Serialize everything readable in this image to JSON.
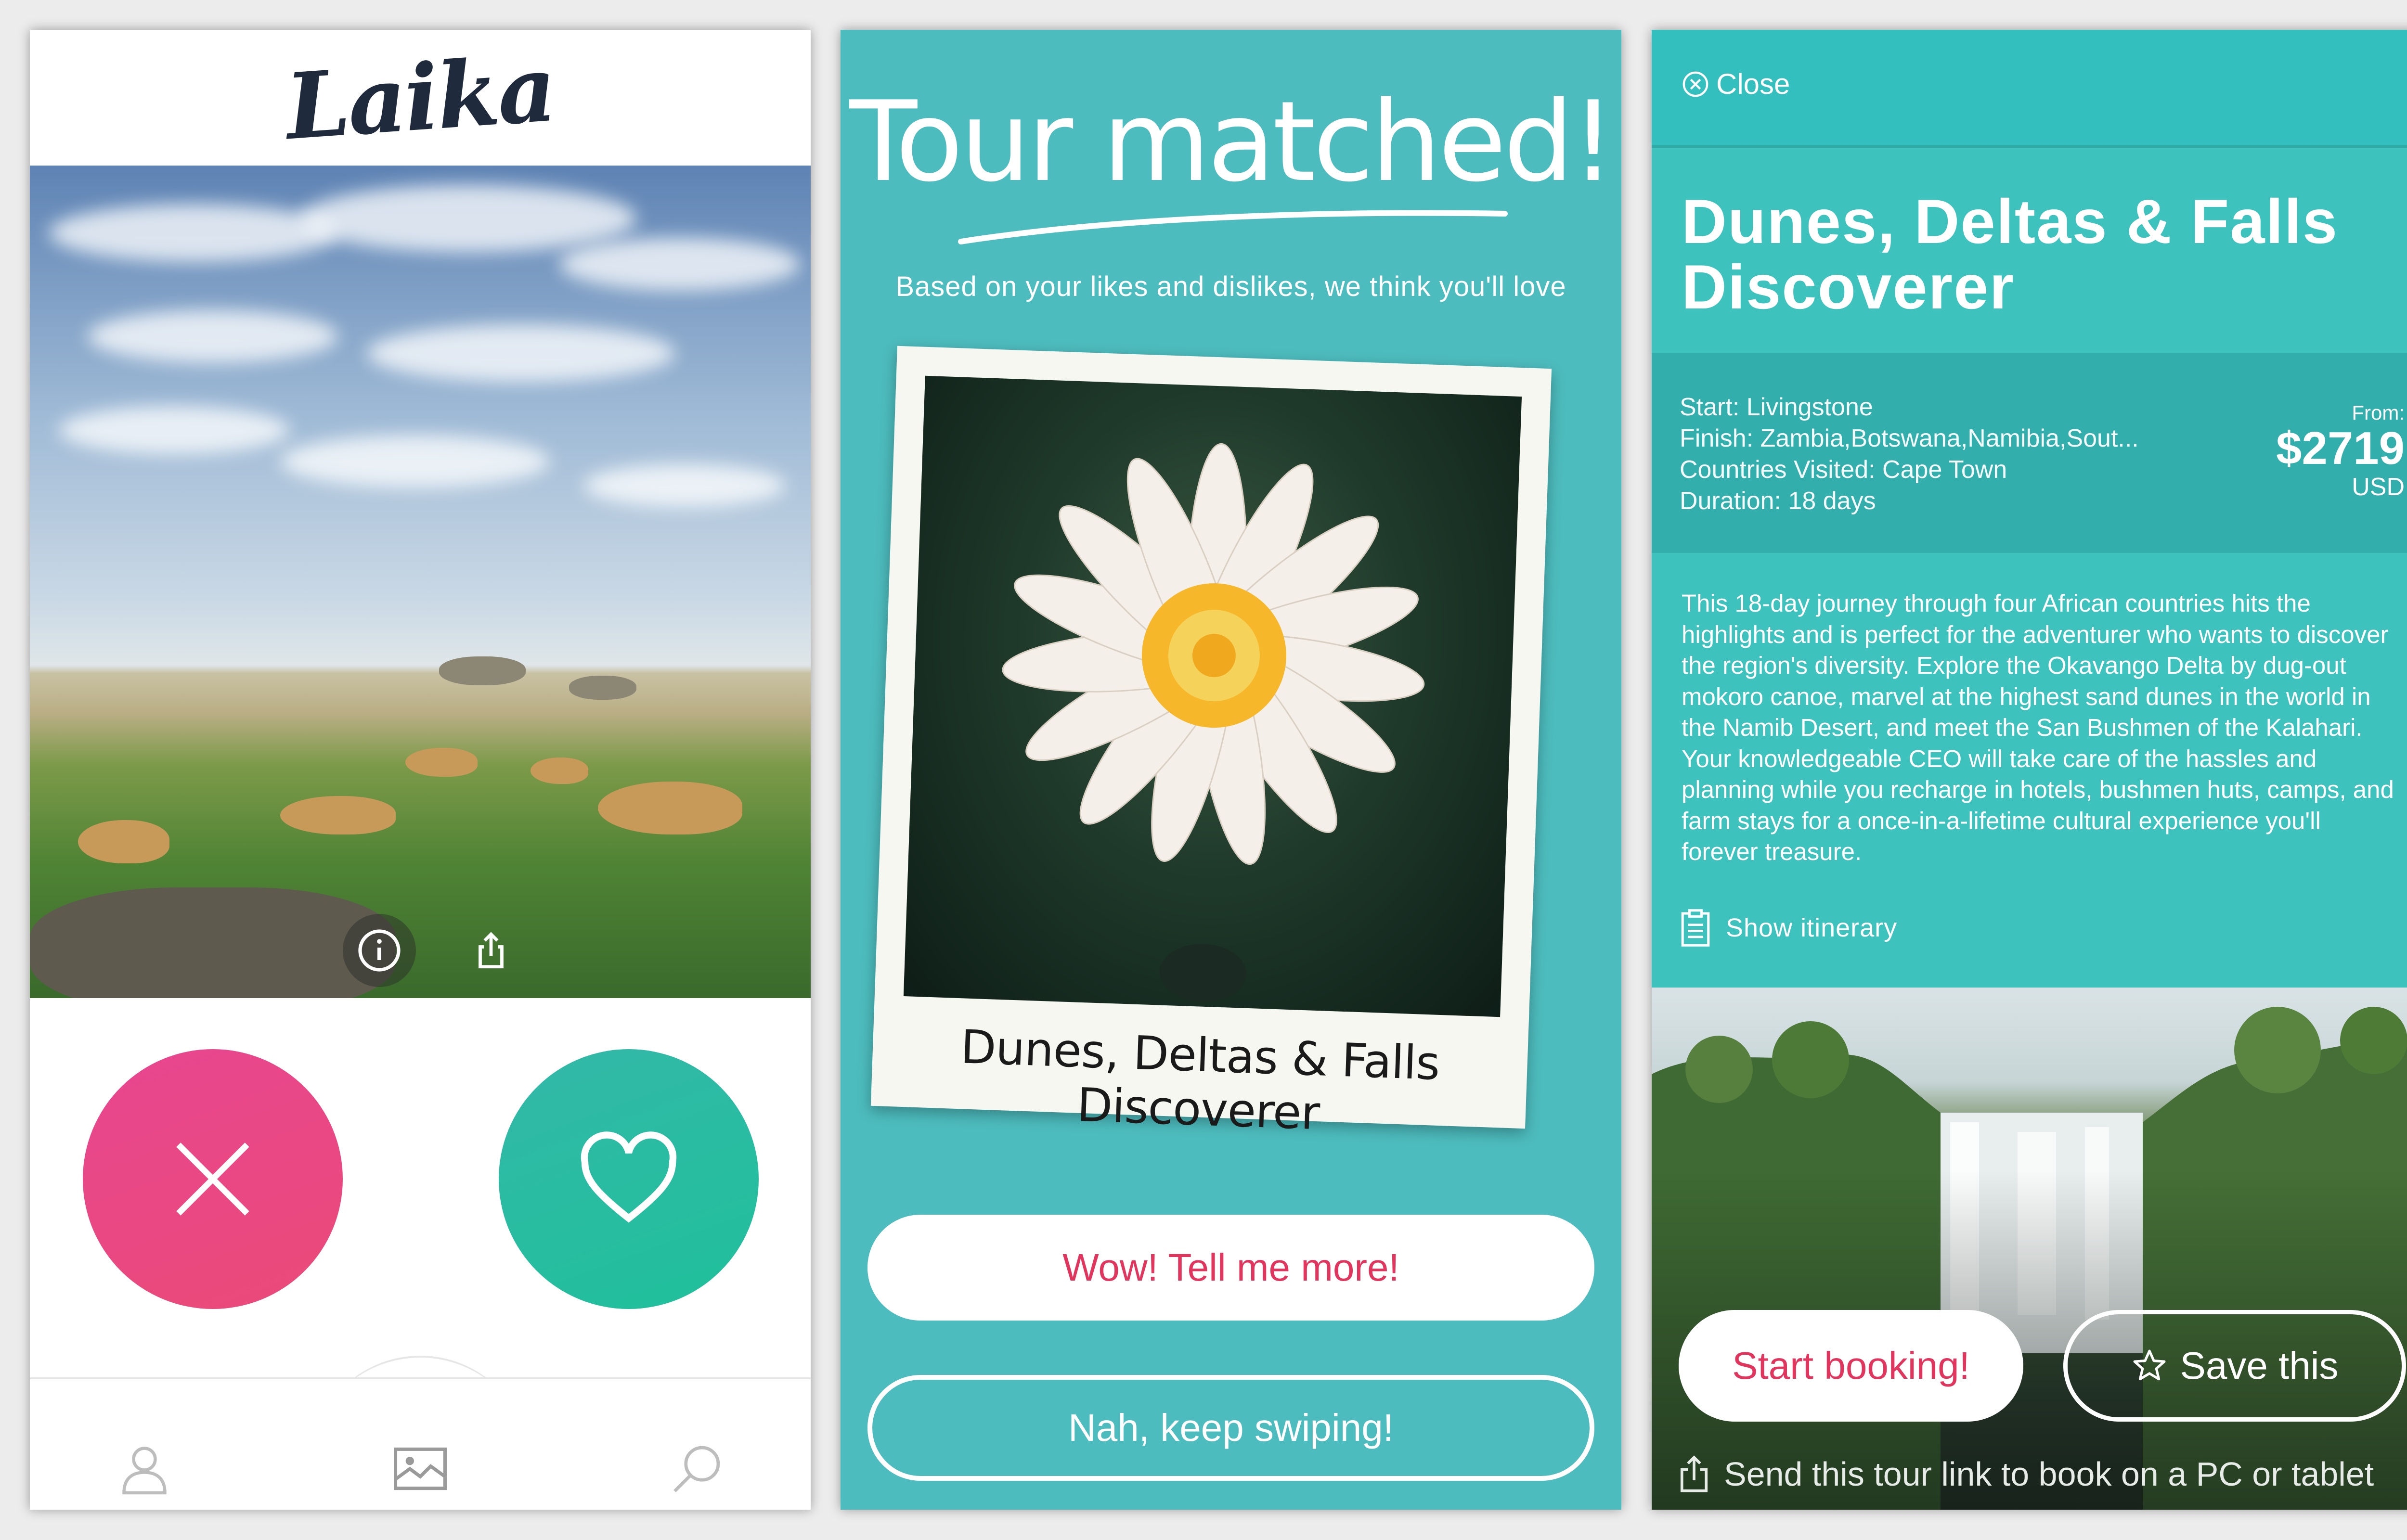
{
  "screen1": {
    "app_name": "Laika",
    "photo_buttons": {
      "info_icon": "info-icon",
      "share_icon": "share-icon"
    },
    "action_buttons": {
      "dislike_icon": "close-x-icon",
      "like_icon": "heart-icon"
    },
    "tabs": [
      "profile-icon",
      "gallery-icon",
      "search-icon"
    ]
  },
  "screen2": {
    "title": "Tour matched!",
    "subtitle": "Based on your likes and dislikes, we think you'll love",
    "polaroid_caption": "Dunes, Deltas & Falls Discoverer",
    "primary_button": "Wow! Tell me more!",
    "secondary_button": "Nah, keep swiping!"
  },
  "screen3": {
    "close_label": "Close",
    "title": "Dunes, Deltas & Falls Discoverer",
    "info": [
      {
        "key": "Start:",
        "value": "Livingstone"
      },
      {
        "key": "Finish:",
        "value": "Zambia,Botswana,Namibia,Sout..."
      },
      {
        "key": "Countries Visited:",
        "value": "Cape Town"
      },
      {
        "key": "Duration:",
        "value": "18 days"
      }
    ],
    "price": {
      "from_label": "From:",
      "amount": "$2719",
      "currency": "USD"
    },
    "description": "This 18-day journey through four African countries hits the highlights and is perfect for the adventurer who wants to discover the region's diversity. Explore the Okavango Delta by dug-out mokoro canoe, marvel at the highest sand dunes in the world in the Namib Desert, and meet the San Bushmen of the Kalahari. Your knowledgeable CEO will take care of the hassles and planning while you recharge in hotels, bushmen huts, camps, and farm stays for a once-in-a-lifetime cultural experience you'll forever treasure.",
    "itinerary_label": "Show itinerary",
    "start_booking_label": "Start booking!",
    "save_label": "Save this",
    "send_link_label": "Send this tour link to book on a PC or tablet"
  },
  "colors": {
    "teal": "#3ec2bd",
    "teal_dark": "#32aead",
    "pink": "#e84690",
    "green": "#1fc09b",
    "cta_red": "#e2355d",
    "logo_navy": "#1f2a3c"
  }
}
